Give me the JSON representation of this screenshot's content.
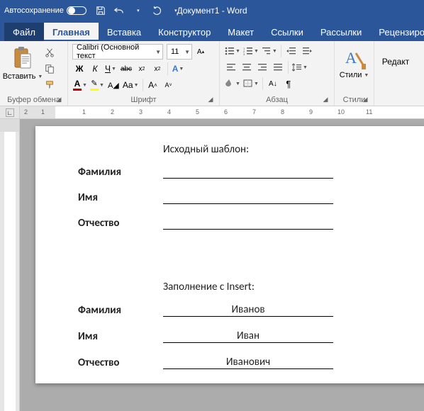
{
  "titlebar": {
    "autosave_label": "Автосохранение",
    "document_name": "Документ1  -  Word"
  },
  "tabs": {
    "file": "Файл",
    "home": "Главная",
    "insert": "Вставка",
    "design": "Конструктор",
    "layout": "Макет",
    "references": "Ссылки",
    "mailings": "Рассылки",
    "review": "Рецензиров"
  },
  "ribbon": {
    "clipboard": {
      "paste": "Вставить",
      "label": "Буфер обмена"
    },
    "font": {
      "font_name": "Calibri (Основной текст",
      "font_size": "11",
      "label": "Шрифт",
      "bold": "Ж",
      "italic": "К",
      "underline": "Ч",
      "strike": "abc",
      "aa": "Aa"
    },
    "paragraph": {
      "label": "Абзац"
    },
    "styles": {
      "label": "Стили",
      "btn": "Стили",
      "glyph": "A"
    },
    "editing": {
      "label": "Редакт"
    }
  },
  "ruler": {
    "marks": [
      "2",
      "1",
      "",
      "1",
      "2",
      "3",
      "4",
      "5",
      "6",
      "7",
      "8",
      "9",
      "10",
      "11"
    ]
  },
  "document": {
    "section1_title": "Исходный шаблон:",
    "section2_title": "Заполнение с Insert:",
    "labels": {
      "surname": "Фамилия",
      "name": "Имя",
      "patronymic": "Отчество"
    },
    "values_empty": {
      "surname": "",
      "name": "",
      "patronymic": ""
    },
    "values_filled": {
      "surname": "Иванов",
      "name": "Иван",
      "patronymic": "Иванович"
    }
  }
}
